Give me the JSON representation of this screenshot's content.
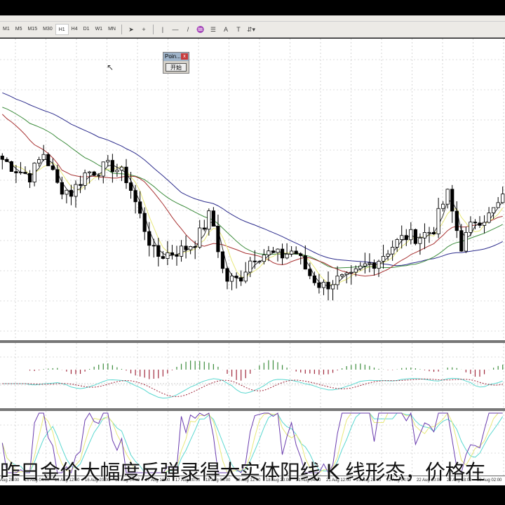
{
  "toolbar": {
    "timeframes": [
      "M1",
      "M5",
      "M15",
      "M30",
      "H1",
      "H4",
      "D1",
      "W1",
      "MN"
    ],
    "active_timeframe": "H1",
    "tools": [
      "cursor-arrow",
      "crosshair",
      "vertical-line",
      "horizontal-line",
      "trendline",
      "fibonacci",
      "channel",
      "text",
      "text-label",
      "arrows"
    ]
  },
  "ea_panel": {
    "title": "Poin...",
    "close": "x",
    "start_button": "开始"
  },
  "time_axis": [
    "15 Aug 20:00",
    "16 Aug 04:00",
    "16 Aug 12:00",
    "16 Aug 20:00",
    "17 Aug 04:00",
    "17 Aug 12:00",
    "17 Aug 20:00",
    "18 Aug 04:00",
    "18 Aug 12:00",
    "18 Aug 20:00",
    "21 Aug 04:00",
    "21 Aug 12:00",
    "21 Aug 20:00",
    "22 Aug 04:00",
    "22 Aug 10:00",
    "22 Aug 18:00",
    "23 Aug 02:00"
  ],
  "subtitle": "昨日金价大幅度反弹录得大实体阳线 K 线形态，价格在",
  "colors": {
    "bull": "#ffffff",
    "bear": "#000000",
    "ma_fast": "#e8e87a",
    "ma_mid": "#a83232",
    "ma_slow": "#3c8c3c",
    "ma_long": "#2c2c8c",
    "macd_hist_pos": "#3c8c3c",
    "macd_hist_neg": "#a0283c",
    "macd_main": "#5ad8d0",
    "macd_signal": "#a0283c",
    "stoch_main": "#6a3cae",
    "stoch_sig": "#e8e87a",
    "stoch_slow": "#5ad8d0"
  },
  "chart_data": {
    "type": "candlestick",
    "symbol_note": "price key closes (interpolated per bar)",
    "key_closes": [
      1296.0,
      1294.5,
      1293.5,
      1297.0,
      1292.0,
      1291.0,
      1294.0,
      1294.5,
      1295.0,
      1293.0,
      1287.0,
      1281.5,
      1282.0,
      1282.5,
      1284.0,
      1288.0,
      1278.0,
      1278.0,
      1281.5,
      1282.0,
      1281.5,
      1282.5,
      1279.0,
      1277.0,
      1278.0,
      1278.0,
      1280.0,
      1281.0,
      1283.0,
      1284.5,
      1284.5,
      1285.5,
      1291.0,
      1283.0,
      1287.0,
      1287.5,
      1290.0
    ],
    "ylim": [
      1269,
      1314
    ]
  }
}
